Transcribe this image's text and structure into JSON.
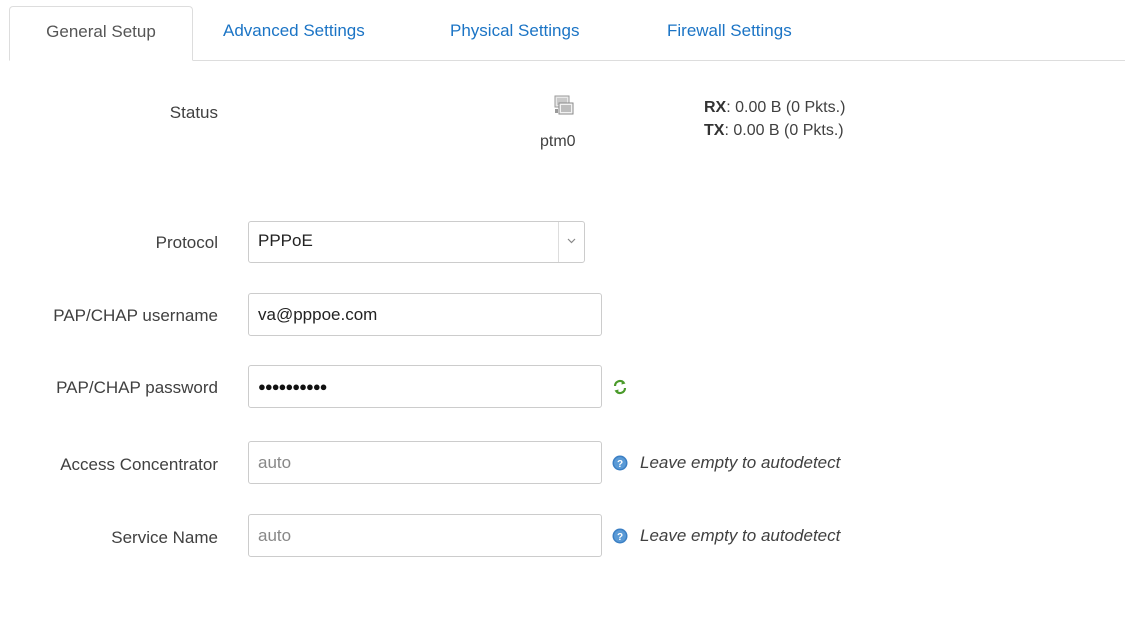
{
  "tabs": [
    {
      "label": "General Setup",
      "active": true
    },
    {
      "label": "Advanced Settings",
      "active": false
    },
    {
      "label": "Physical Settings",
      "active": false
    },
    {
      "label": "Firewall Settings",
      "active": false
    }
  ],
  "status": {
    "label": "Status",
    "interface_icon": "network-interface-icon",
    "interface_name": "ptm0",
    "rx_label": "RX",
    "rx_value": ": 0.00 B (0 Pkts.)",
    "tx_label": "TX",
    "tx_value": ": 0.00 B (0 Pkts.)"
  },
  "protocol": {
    "label": "Protocol",
    "selected": "PPPoE"
  },
  "username": {
    "label": "PAP/CHAP username",
    "value": "va@pppoe.com"
  },
  "password": {
    "label": "PAP/CHAP password",
    "masked": "●●●●●●●●●●",
    "reveal_icon": "refresh-icon"
  },
  "access_concentrator": {
    "label": "Access Concentrator",
    "placeholder": "auto",
    "help_icon": "help-icon",
    "hint": "Leave empty to autodetect"
  },
  "service_name": {
    "label": "Service Name",
    "placeholder": "auto",
    "help_icon": "help-icon",
    "hint": "Leave empty to autodetect"
  },
  "colors": {
    "tab_link": "#1b74c5",
    "border": "#cccccc",
    "text": "#404040"
  }
}
